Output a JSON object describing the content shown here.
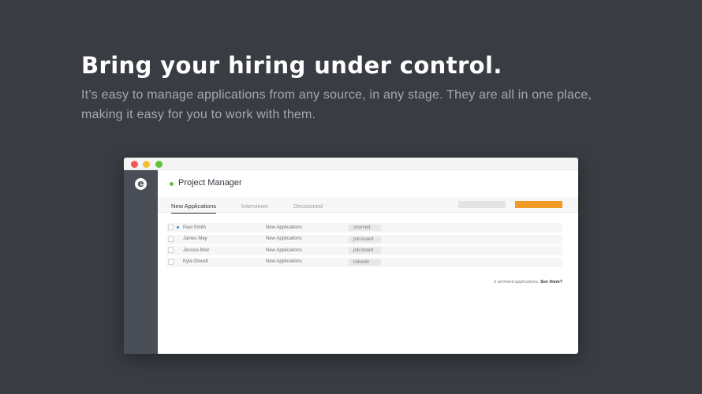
{
  "hero": {
    "headline": "Bring your hiring under control.",
    "subtext": "It’s easy to manage applications from any source, in any stage. They are all in one place, making it easy for you to work with them."
  },
  "colors": {
    "background": "#393c42",
    "sidebar": "#4a4f57",
    "accent_orange": "#f29a28",
    "status_green": "#6bbd3b",
    "flag_blue": "#3a86d6"
  },
  "app": {
    "logo_glyph": "e",
    "job_title": "Project Manager",
    "tabs": [
      {
        "label": "New Applications",
        "active": true
      },
      {
        "label": "Interviews",
        "active": false
      },
      {
        "label": "Decisioned",
        "active": false
      }
    ],
    "applications": [
      {
        "name": "Paul Smith",
        "stage": "New Applications",
        "source": "sourced",
        "flagged": true
      },
      {
        "name": "James May",
        "stage": "New Applications",
        "source": "job-board",
        "flagged": false
      },
      {
        "name": "Jessica Moir",
        "stage": "New Applications",
        "source": "job-board",
        "flagged": false
      },
      {
        "name": "Kyla Oswalt",
        "stage": "New Applications",
        "source": "linkedin",
        "flagged": false
      }
    ],
    "archived_text": "5 archived applications.",
    "archived_link": "See them?"
  }
}
